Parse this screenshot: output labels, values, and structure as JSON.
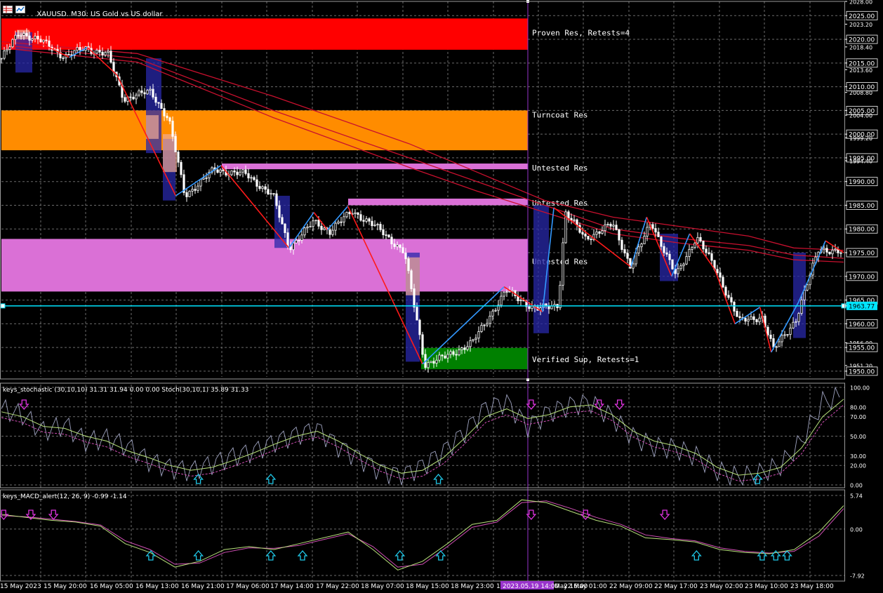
{
  "header": {
    "symbol": "XAUUSD.",
    "timeframe": "M30:",
    "description": "US Gold vs US dollar",
    "title": "XAUUSD., M30: US Gold vs US dollar"
  },
  "colors": {
    "background": "#000000",
    "grid": "#6b6b6b",
    "candle": "#ffffff",
    "ma": "#c8102e",
    "zigzag_down": "#ff1a1a",
    "zigzag_up": "#3399ff",
    "hline": "#00e5ff",
    "vline": "#9933cc",
    "zone_proven_res": "#ff0000",
    "zone_turncoat_res": "#ff8c00",
    "zone_untested_res": "#da70d6",
    "zone_verified_sup": "#008000",
    "stoch_main": "#9fa3c0",
    "stoch_signal": "#b7e07a",
    "stoch_dashed": "#d14fb5",
    "macd_main": "#b7e07a",
    "macd_signal": "#d14fb5",
    "arrow_down": "#e033e0",
    "arrow_up": "#20c8e8"
  },
  "zones": [
    {
      "label": "Proven Res, Retests=4",
      "top": 2024.4,
      "bottom": 2017.8,
      "color": "#ff0000"
    },
    {
      "label": "Turncoat Res",
      "top": 2005.0,
      "bottom": 1996.6,
      "color": "#ff8c00"
    },
    {
      "label": "Untested Res",
      "top": 1993.8,
      "bottom": 1992.6,
      "color": "#da70d6"
    },
    {
      "label": "Untested Res",
      "top": 1986.4,
      "bottom": 1985.0,
      "color": "#da70d6"
    },
    {
      "label": "Untested Res",
      "top": 1977.9,
      "bottom": 1966.8,
      "color": "#da70d6"
    },
    {
      "label": "Verified Sup, Retests=1",
      "top": 1954.9,
      "bottom": 1950.4,
      "color": "#008000"
    }
  ],
  "chart_data": [
    {
      "type": "candlestick",
      "title": "XAUUSD., M30: US Gold vs US dollar",
      "ylim": [
        1948.8,
        2028.0
      ],
      "price_axis_labels": [
        "2028.00",
        "2025.00",
        "2023.20",
        "2020.00",
        "2018.40",
        "2015.00",
        "2013.60",
        "2010.00",
        "2008.80",
        "2005.00",
        "2004.00",
        "2000.00",
        "1999.20",
        "1995.00",
        "1994.40",
        "1990.00",
        "1985.00",
        "1980.00",
        "1975.00",
        "1970.00",
        "1965.00",
        "1963.77",
        "1960.00",
        "1956.00",
        "1955.00",
        "1951.20",
        "1950.00"
      ],
      "highlighted_price_labels": [
        "2025.00",
        "2020.00",
        "2015.00",
        "2010.00",
        "2005.00",
        "2000.00",
        "1995.00",
        "1990.00",
        "1985.00",
        "1980.00",
        "1975.00",
        "1970.00",
        "1965.00",
        "1960.00",
        "1955.00",
        "1950.00"
      ],
      "current_price": 1963.77,
      "time_labels": [
        "15 May 2023",
        "15 May 20:00",
        "16 May 05:00",
        "16 May 13:00",
        "16 May 21:00",
        "17 May 06:00",
        "17 May 14:00",
        "17 May 22:00",
        "18 May 07:00",
        "18 May 15:00",
        "18 May 23:00",
        "19 May 08:00",
        "22 May 01:00",
        "22 May 09:00",
        "22 May 17:00",
        "23 May 02:00",
        "23 May 10:00",
        "23 May 18:00"
      ],
      "highlighted_time": "2023.05.19 14:00",
      "highlighted_time_trailing": "May 16:00",
      "price_path": [
        {
          "t": 0.0,
          "price": 2016.0
        },
        {
          "t": 0.4,
          "price": 2021.5
        },
        {
          "t": 0.9,
          "price": 2019.5
        },
        {
          "t": 1.4,
          "price": 2016.3
        },
        {
          "t": 1.85,
          "price": 2018.2
        },
        {
          "t": 2.35,
          "price": 2016.8
        },
        {
          "t": 2.7,
          "price": 2007.5
        },
        {
          "t": 3.3,
          "price": 2009.0
        },
        {
          "t": 3.7,
          "price": 2003.0
        },
        {
          "t": 4.05,
          "price": 1987.0
        },
        {
          "t": 4.7,
          "price": 1992.5
        },
        {
          "t": 5.4,
          "price": 1991.5
        },
        {
          "t": 6.0,
          "price": 1987.0
        },
        {
          "t": 6.35,
          "price": 1976.0
        },
        {
          "t": 6.9,
          "price": 1981.5
        },
        {
          "t": 7.25,
          "price": 1979.5
        },
        {
          "t": 7.75,
          "price": 1983.8
        },
        {
          "t": 8.4,
          "price": 1979.5
        },
        {
          "t": 8.9,
          "price": 1975.0
        },
        {
          "t": 9.35,
          "price": 1951.5
        },
        {
          "t": 9.8,
          "price": 1953.0
        },
        {
          "t": 10.4,
          "price": 1956.0
        },
        {
          "t": 11.15,
          "price": 1967.0
        },
        {
          "t": 11.8,
          "price": 1963.0
        },
        {
          "t": 12.3,
          "price": 1964.0
        },
        {
          "t": 12.45,
          "price": 1983.5
        },
        {
          "t": 12.9,
          "price": 1978.0
        },
        {
          "t": 13.5,
          "price": 1981.0
        },
        {
          "t": 13.9,
          "price": 1972.0
        },
        {
          "t": 14.35,
          "price": 1981.5
        },
        {
          "t": 14.9,
          "price": 1970.0
        },
        {
          "t": 15.35,
          "price": 1978.5
        },
        {
          "t": 15.8,
          "price": 1971.0
        },
        {
          "t": 16.3,
          "price": 1960.5
        },
        {
          "t": 16.8,
          "price": 1961.5
        },
        {
          "t": 17.05,
          "price": 1954.5
        },
        {
          "t": 17.55,
          "price": 1961.0
        },
        {
          "t": 18.05,
          "price": 1976.0
        },
        {
          "t": 18.6,
          "price": 1974.8
        }
      ],
      "zigzag": [
        {
          "t": 0.9,
          "price": 2019.0
        },
        {
          "t": 1.5,
          "price": 2016.2
        },
        {
          "t": 1.9,
          "price": 2018.3
        },
        {
          "t": 2.55,
          "price": 2012.5
        },
        {
          "t": 3.85,
          "price": 1987.0
        },
        {
          "t": 4.85,
          "price": 1993.4
        },
        {
          "t": 6.35,
          "price": 1976.0
        },
        {
          "t": 6.9,
          "price": 1983.5
        },
        {
          "t": 7.2,
          "price": 1979.8
        },
        {
          "t": 7.65,
          "price": 1984.8
        },
        {
          "t": 9.3,
          "price": 1951.5
        },
        {
          "t": 11.1,
          "price": 1967.8
        },
        {
          "t": 11.95,
          "price": 1962.5
        },
        {
          "t": 12.2,
          "price": 1984.5
        },
        {
          "t": 13.9,
          "price": 1972.0
        },
        {
          "t": 14.25,
          "price": 1982.5
        },
        {
          "t": 14.8,
          "price": 1970.0
        },
        {
          "t": 15.2,
          "price": 1979.0
        },
        {
          "t": 15.75,
          "price": 1971.5
        },
        {
          "t": 16.2,
          "price": 1960.0
        },
        {
          "t": 16.75,
          "price": 1963.5
        },
        {
          "t": 17.0,
          "price": 1954.0
        },
        {
          "t": 17.6,
          "price": 1964.5
        },
        {
          "t": 18.2,
          "price": 1977.5
        },
        {
          "t": 18.6,
          "price": 1975.0
        }
      ],
      "moving_averages": [
        {
          "points": [
            {
              "t": 0.0,
              "price": 2018.8
            },
            {
              "t": 3.0,
              "price": 2016.0
            },
            {
              "t": 6.0,
              "price": 2005.0
            },
            {
              "t": 9.0,
              "price": 1995.0
            },
            {
              "t": 10.5,
              "price": 1990.0
            },
            {
              "t": 12.0,
              "price": 1985.0
            },
            {
              "t": 13.5,
              "price": 1980.0
            },
            {
              "t": 15.0,
              "price": 1978.0
            },
            {
              "t": 16.5,
              "price": 1976.5
            },
            {
              "t": 17.5,
              "price": 1974.5
            },
            {
              "t": 18.6,
              "price": 1973.8
            }
          ]
        },
        {
          "points": [
            {
              "t": 0.0,
              "price": 2018.2
            },
            {
              "t": 3.0,
              "price": 2015.2
            },
            {
              "t": 6.0,
              "price": 2003.5
            },
            {
              "t": 9.0,
              "price": 1993.0
            },
            {
              "t": 10.5,
              "price": 1988.0
            },
            {
              "t": 12.0,
              "price": 1983.5
            },
            {
              "t": 13.5,
              "price": 1979.0
            },
            {
              "t": 15.0,
              "price": 1977.0
            },
            {
              "t": 16.5,
              "price": 1975.5
            },
            {
              "t": 17.5,
              "price": 1973.5
            },
            {
              "t": 18.6,
              "price": 1973.0
            }
          ]
        },
        {
          "points": [
            {
              "t": 0.0,
              "price": 2019.5
            },
            {
              "t": 3.0,
              "price": 2017.0
            },
            {
              "t": 6.0,
              "price": 2008.0
            },
            {
              "t": 9.0,
              "price": 1998.0
            },
            {
              "t": 10.5,
              "price": 1992.0
            },
            {
              "t": 12.0,
              "price": 1986.0
            },
            {
              "t": 13.5,
              "price": 1982.5
            },
            {
              "t": 15.0,
              "price": 1980.5
            },
            {
              "t": 16.5,
              "price": 1978.5
            },
            {
              "t": 17.5,
              "price": 1976.0
            },
            {
              "t": 18.6,
              "price": 1975.5
            }
          ]
        }
      ]
    },
    {
      "type": "line",
      "title": "keys_stochastic (30,10,10) 31.31 31.94 0.00 0.00 Stoch(30,10,1) 35.89 31.33",
      "ylim": [
        0,
        100
      ],
      "axis_labels": [
        "100.00",
        "80.00",
        "70.00",
        "50.00",
        "30.00",
        "20.00",
        "0.00"
      ],
      "series": [
        {
          "name": "Stoch(30,10,1)",
          "values": [
            78,
            72,
            55,
            62,
            45,
            48,
            40,
            25,
            18,
            15,
            22,
            30,
            35,
            45,
            52,
            58,
            40,
            28,
            15,
            10,
            20,
            35,
            55,
            80,
            85,
            60,
            75,
            82,
            85,
            70,
            50,
            40,
            38,
            30,
            15,
            8,
            12,
            20,
            45,
            85,
            92
          ]
        },
        {
          "name": "keys_stochastic",
          "values": [
            75,
            70,
            60,
            58,
            50,
            45,
            35,
            28,
            20,
            15,
            18,
            25,
            33,
            42,
            50,
            55,
            45,
            32,
            20,
            12,
            15,
            28,
            48,
            70,
            78,
            68,
            72,
            80,
            82,
            72,
            55,
            45,
            40,
            32,
            18,
            10,
            12,
            18,
            38,
            70,
            88
          ]
        }
      ],
      "down_arrows_t": [
        0.5,
        11.7,
        13.2,
        13.65
      ],
      "up_arrows_t": [
        4.35,
        5.95,
        9.65,
        16.7
      ]
    },
    {
      "type": "line",
      "title": "keys_MACD_alert(12, 26, 9) -0.99 -1.14",
      "ylim": [
        -7.92,
        5.74
      ],
      "axis_labels": [
        "5.74",
        "0.00",
        "-7.92"
      ],
      "series": [
        {
          "name": "MACD",
          "values": [
            2.5,
            2.0,
            1.5,
            1.2,
            0.5,
            -2.5,
            -4.0,
            -6.5,
            -5.5,
            -3.5,
            -3.0,
            -3.5,
            -2.5,
            -1.5,
            -0.5,
            -3.5,
            -7.0,
            -5.5,
            -2.5,
            0.8,
            1.5,
            5.0,
            4.5,
            3.0,
            1.5,
            0.5,
            -1.5,
            -1.8,
            -2.2,
            -3.5,
            -4.0,
            -4.2,
            -3.5,
            -0.5,
            4.0
          ]
        },
        {
          "name": "Signal",
          "values": [
            2.3,
            2.1,
            1.7,
            1.3,
            0.7,
            -2.0,
            -3.5,
            -6.0,
            -5.8,
            -4.0,
            -3.2,
            -3.3,
            -2.8,
            -1.8,
            -0.8,
            -3.0,
            -6.5,
            -6.0,
            -3.0,
            0.3,
            1.2,
            4.5,
            4.8,
            3.5,
            2.0,
            0.8,
            -1.0,
            -1.6,
            -2.0,
            -3.2,
            -3.8,
            -4.1,
            -3.8,
            -1.2,
            3.5
          ]
        }
      ],
      "down_arrows_t": [
        0.05,
        0.65,
        1.15,
        11.7,
        12.9,
        14.65
      ],
      "up_arrows_t": [
        3.3,
        4.35,
        5.95,
        6.65,
        8.8,
        9.7,
        15.35,
        16.8,
        17.1,
        17.35
      ]
    }
  ]
}
